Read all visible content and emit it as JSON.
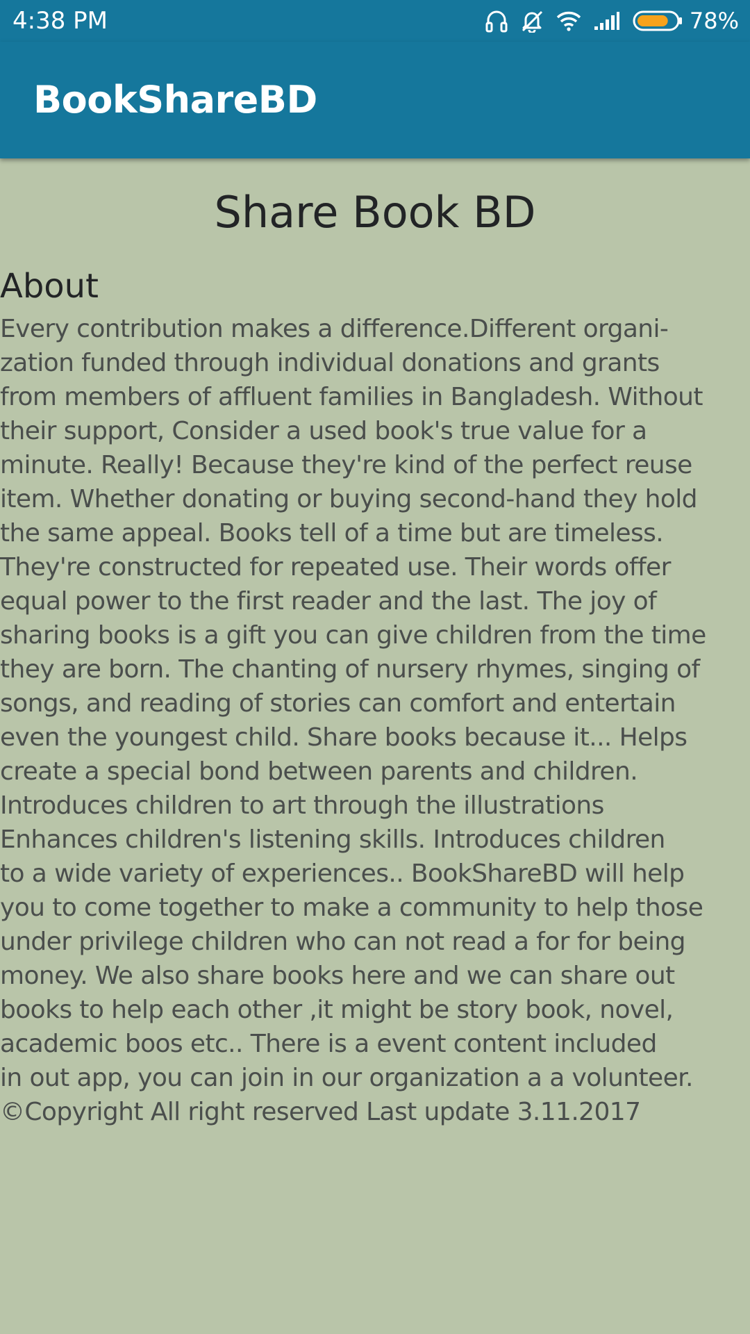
{
  "status_bar": {
    "time": "4:38  PM",
    "icons": [
      "headphones-icon",
      "alarm-muted-icon",
      "wifi-icon",
      "signal-icon",
      "battery-icon"
    ],
    "battery_percent": "78%",
    "battery_level": 0.78,
    "battery_color": "#f7a21b"
  },
  "app_bar": {
    "title": "BookShareBD",
    "background": "#15779c"
  },
  "content": {
    "heading": "Share Book BD",
    "section_title": "About",
    "body": "Every contribution makes a difference.Different organi-\nzation funded through individual donations and grants\nfrom members of affluent families in Bangladesh. Without\ntheir support, Consider a used book's true value for a\nminute. Really! Because they're kind of the perfect reuse\nitem. Whether donating or buying second-hand they hold\nthe same appeal. Books tell of a time but are timeless.\nThey're constructed for repeated use. Their words offer\nequal power to the first reader and the last. The joy of\nsharing books is a gift you can give children from the time\nthey are born. The chanting of nursery rhymes, singing of\nsongs, and reading of stories can comfort and entertain\neven the youngest child. Share books because it... Helps\ncreate a special bond between parents and children.\nIntroduces children to art through the illustrations\nEnhances children's listening skills. Introduces children\nto a wide variety of experiences.. BookShareBD will help\nyou to come together to make a community to help those\nunder privilege children who can not read a for for being\nmoney. We also share books here and we can share out\nbooks to help each other ,it might be story book, novel,\nacademic boos etc.. There is a event content included\nin out app, you can join in our organization a a volunteer.\n©Copyright All right reserved Last update 3.11.2017",
    "background": "#b9c5a9"
  }
}
